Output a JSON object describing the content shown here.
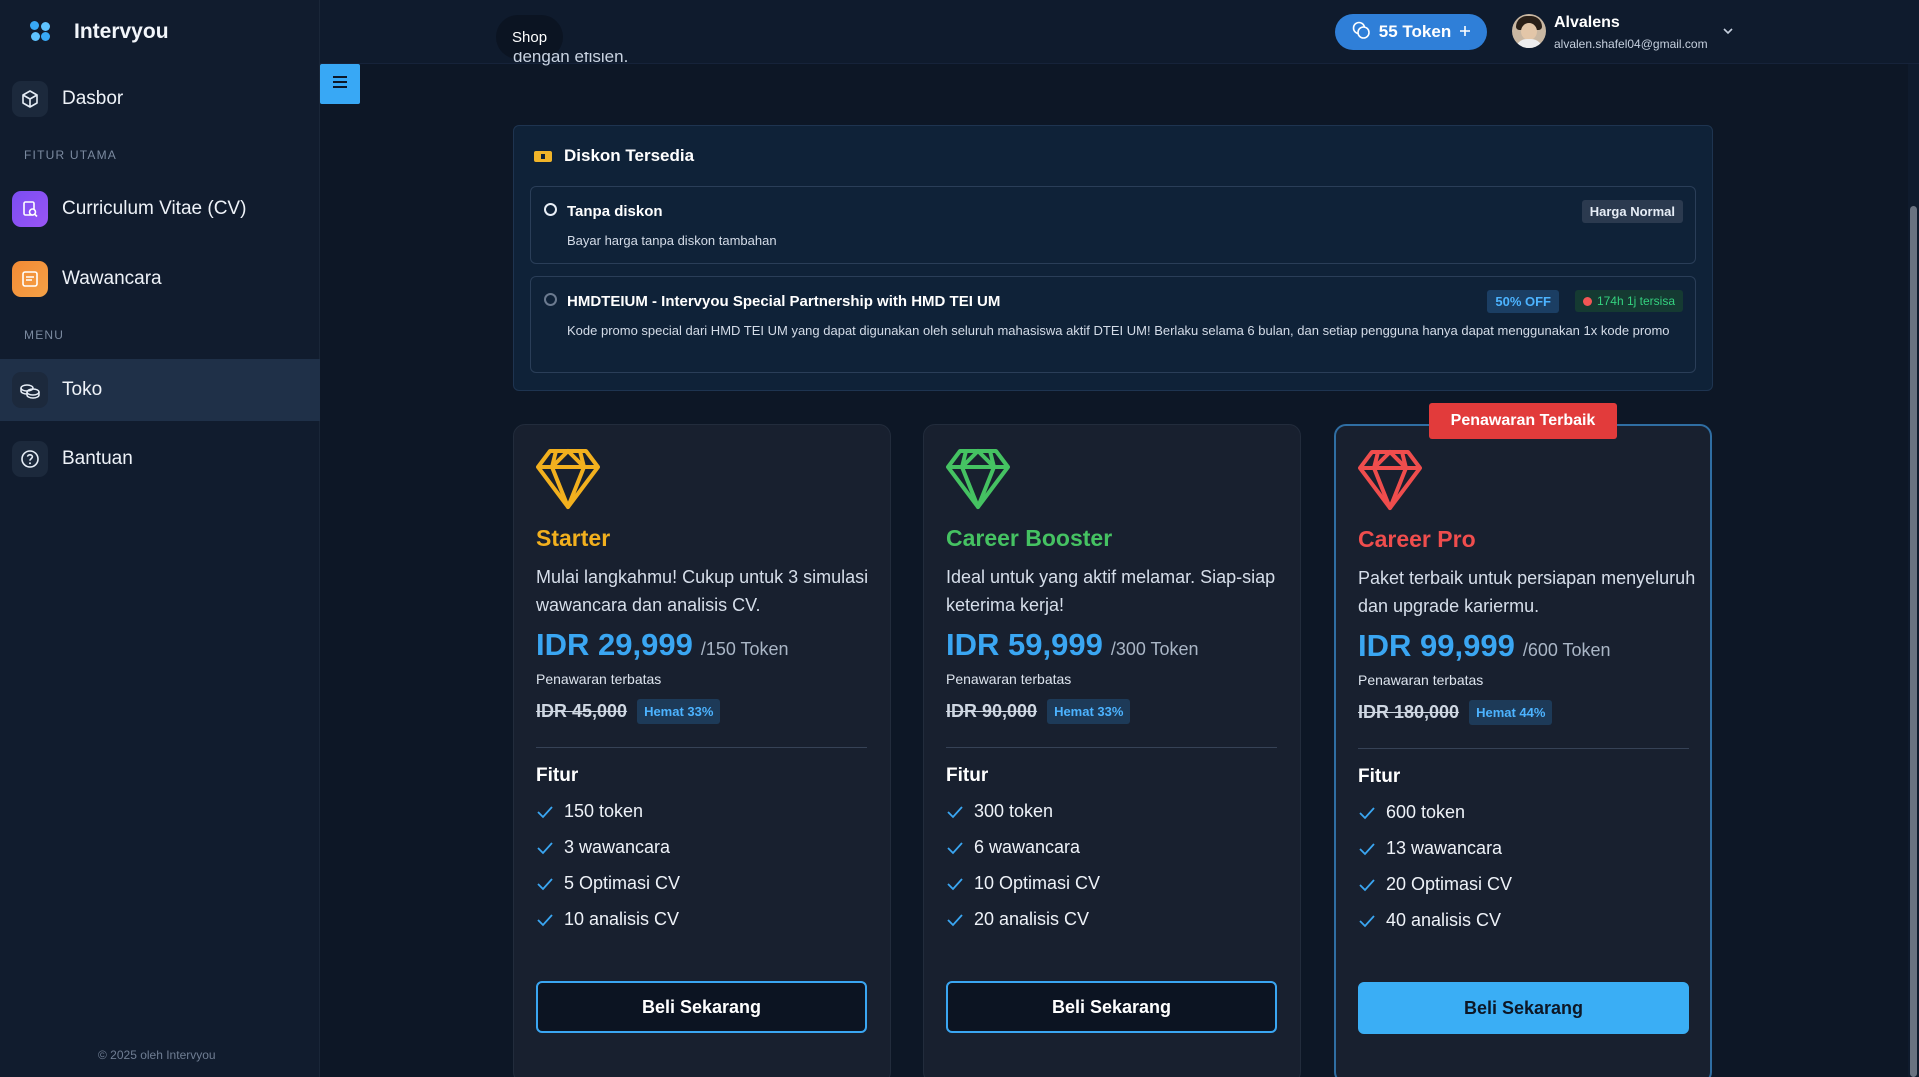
{
  "app": {
    "name": "Intervyou"
  },
  "sidebar": {
    "items": [
      {
        "label": "Dasbor"
      },
      {
        "label": "Curriculum Vitae (CV)"
      },
      {
        "label": "Wawancara"
      },
      {
        "label": "Toko"
      },
      {
        "label": "Bantuan"
      }
    ],
    "sections": {
      "main": "FITUR UTAMA",
      "menu": "MENU"
    },
    "footer": "© 2025 oleh Intervyou"
  },
  "topbar": {
    "shop": "Shop",
    "tokens": "55 Token",
    "user_name": "Alvalens",
    "user_email": "alvalen.shafel04@gmail.com"
  },
  "cut_text": "dengan efisien.",
  "discounts": {
    "title": "Diskon Tersedia",
    "options": [
      {
        "title": "Tanpa diskon",
        "desc": "Bayar harga tanpa diskon tambahan",
        "badge": "Harga Normal",
        "selected": true
      },
      {
        "title": "HMDTEIUM - Intervyou Special Partnership with HMD TEI UM",
        "desc": "Kode promo special dari HMD TEI UM yang dapat digunakan oleh seluruh mahasiswa aktif DTEI UM! Berlaku selama 6 bulan, dan setiap pengguna hanya dapat menggunakan 1x kode promo",
        "badge_off": "50% OFF",
        "badge_time": "174h 1j tersisa",
        "selected": false
      }
    ]
  },
  "best_offer": "Penawaran Terbaik",
  "plans": [
    {
      "name": "Starter",
      "color": "#f2b01e",
      "desc": "Mulai langkahmu! Cukup untuk 3 simulasi wawancara dan analisis CV.",
      "price": "IDR 29,999",
      "per": "/150 Token",
      "limited": "Penawaran terbatas",
      "old_price": "IDR 45,000",
      "save": "Hemat 33%",
      "features_title": "Fitur",
      "features": [
        "150 token",
        "3 wawancara",
        "5 Optimasi CV",
        "10 analisis CV"
      ],
      "cta": "Beli Sekarang"
    },
    {
      "name": "Career Booster",
      "color": "#45c262",
      "desc": "Ideal untuk yang aktif melamar. Siap-siap keterima kerja!",
      "price": "IDR 59,999",
      "per": "/300 Token",
      "limited": "Penawaran terbatas",
      "old_price": "IDR 90,000",
      "save": "Hemat 33%",
      "features_title": "Fitur",
      "features": [
        "300 token",
        "6 wawancara",
        "10 Optimasi CV",
        "20 analisis CV"
      ],
      "cta": "Beli Sekarang"
    },
    {
      "name": "Career Pro",
      "color": "#ef4d4d",
      "desc": "Paket terbaik untuk persiapan menyeluruh dan upgrade kariermu.",
      "price": "IDR 99,999",
      "per": "/600 Token",
      "limited": "Penawaran terbatas",
      "old_price": "IDR 180,000",
      "save": "Hemat 44%",
      "features_title": "Fitur",
      "features": [
        "600 token",
        "13 wawancara",
        "20 Optimasi CV",
        "40 analisis CV"
      ],
      "cta": "Beli Sekarang"
    }
  ],
  "colors": {
    "accent": "#3aa6f2",
    "danger": "#e23b3b",
    "bg": "#0d1726"
  }
}
